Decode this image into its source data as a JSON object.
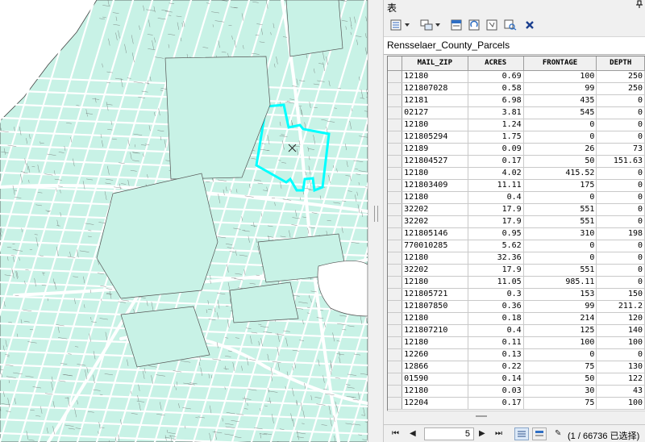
{
  "window": {
    "title": "表",
    "pin_icon": "pin-icon"
  },
  "toolbar": {
    "buttons": [
      {
        "name": "table-options-button",
        "icon": "table-options-icon"
      },
      {
        "name": "related-tables-button",
        "icon": "related-tables-icon"
      },
      {
        "name": "select-by-attributes-button",
        "icon": "select-by-attributes-icon"
      },
      {
        "name": "switch-selection-button",
        "icon": "switch-selection-icon"
      },
      {
        "name": "clear-selection-button",
        "icon": "clear-selection-icon"
      },
      {
        "name": "zoom-to-selected-button",
        "icon": "zoom-to-selected-icon"
      },
      {
        "name": "delete-selected-button",
        "icon": "delete-icon"
      }
    ]
  },
  "table": {
    "name": "Rensselaer_County_Parcels",
    "columns": [
      "MAIL_ZIP",
      "ACRES",
      "FRONTAGE",
      "DEPTH"
    ],
    "rows": [
      [
        "12180",
        "0.69",
        "100",
        "250"
      ],
      [
        "121807028",
        "0.58",
        "99",
        "250"
      ],
      [
        "12181",
        "6.98",
        "435",
        "0"
      ],
      [
        "02127",
        "3.81",
        "545",
        "0"
      ],
      [
        "12180",
        "1.24",
        "0",
        "0"
      ],
      [
        "121805294",
        "1.75",
        "0",
        "0"
      ],
      [
        "12189",
        "0.09",
        "26",
        "73"
      ],
      [
        "121804527",
        "0.17",
        "50",
        "151.63"
      ],
      [
        "12180",
        "4.02",
        "415.52",
        "0"
      ],
      [
        "121803409",
        "11.11",
        "175",
        "0"
      ],
      [
        "12180",
        "0.4",
        "0",
        "0"
      ],
      [
        "32202",
        "17.9",
        "551",
        "0"
      ],
      [
        "32202",
        "17.9",
        "551",
        "0"
      ],
      [
        "121805146",
        "0.95",
        "310",
        "198"
      ],
      [
        "770010285",
        "5.62",
        "0",
        "0"
      ],
      [
        "12180",
        "32.36",
        "0",
        "0"
      ],
      [
        "32202",
        "17.9",
        "551",
        "0"
      ],
      [
        "12180",
        "11.05",
        "985.11",
        "0"
      ],
      [
        "121805721",
        "0.3",
        "153",
        "150"
      ],
      [
        "121807850",
        "0.36",
        "99",
        "211.2"
      ],
      [
        "12180",
        "0.18",
        "214",
        "120"
      ],
      [
        "121807210",
        "0.4",
        "125",
        "140"
      ],
      [
        "12180",
        "0.11",
        "100",
        "100"
      ],
      [
        "12260",
        "0.13",
        "0",
        "0"
      ],
      [
        "12866",
        "0.22",
        "75",
        "130"
      ],
      [
        "01590",
        "0.14",
        "50",
        "122"
      ],
      [
        "12180",
        "0.03",
        "30",
        "43"
      ],
      [
        "12204",
        "0.17",
        "75",
        "100"
      ]
    ]
  },
  "status": {
    "current_record": "5",
    "record_count_text": "(1 / 66736 已选择)",
    "first_label": "⏮",
    "prev_label": "◀",
    "next_label": "▶",
    "last_label": "⏭"
  },
  "map": {
    "parcel_fill": "#c8f2e6",
    "parcel_outline": "#555555",
    "road_color": "#ffffff",
    "selection_color": "#00ffff"
  }
}
